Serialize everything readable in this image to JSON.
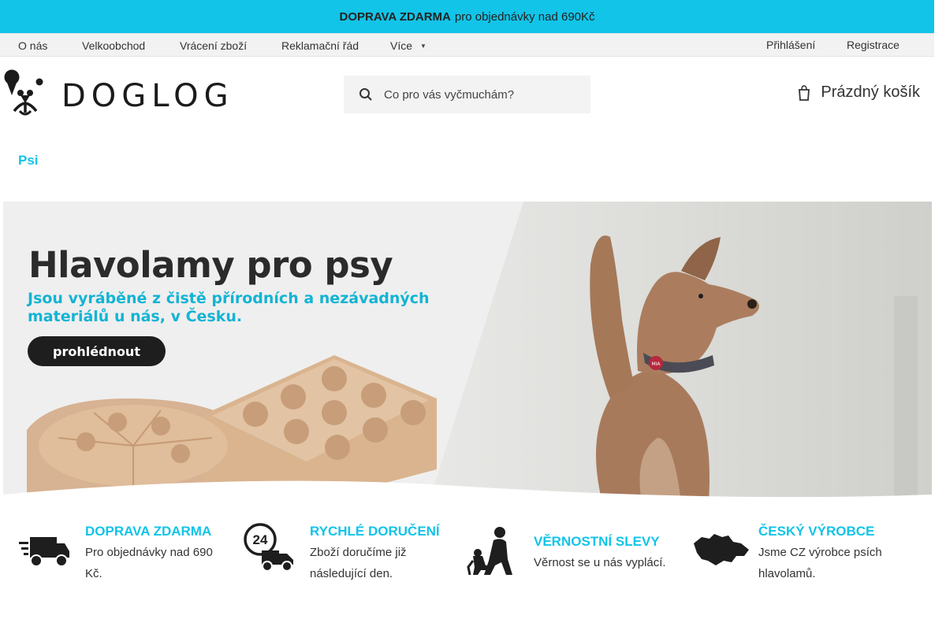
{
  "promo": {
    "bold": "DOPRAVA ZDARMA",
    "text": "pro objednávky nad 690Kč"
  },
  "topnav": {
    "left_items": [
      "O nás",
      "Velkoobchod",
      "Vrácení zboží",
      "Reklamační řád",
      "Více"
    ],
    "right_items": [
      "Přihlášení",
      "Registrace"
    ]
  },
  "logo": {
    "text": "DOGLOG"
  },
  "search": {
    "placeholder": "Co pro vás vyčmuchám?",
    "icon": "search-icon"
  },
  "cart": {
    "label": "Prázdný košík",
    "icon": "cart-icon"
  },
  "breadcrumb": {
    "current": "Psi"
  },
  "banner": {
    "title": "Hlavolamy pro psy",
    "subtitle": "Jsou vyráběné z čistě přírodních a nezávadných materiálů u nás, v Česku.",
    "button": "prohlédnout",
    "tag_text": "MIA"
  },
  "features": [
    {
      "icon": "delivery-truck-icon",
      "title": "DOPRAVA ZDARMA",
      "text": "Pro objednávky nad 690 Kč."
    },
    {
      "icon": "24h-delivery-icon",
      "icon_text": "24",
      "title": "RYCHLÉ DORUČENÍ",
      "text": "Zboží doručíme již následující den."
    },
    {
      "icon": "loyalty-person-dog-icon",
      "title": "VĚRNOSTNÍ SLEVY",
      "text": "Věrnost se u nás vyplácí."
    },
    {
      "icon": "czech-map-icon",
      "title": "ČESKÝ VÝROBCE",
      "text": "Jsme CZ výrobce psích hlavolamů."
    }
  ],
  "colors": {
    "accent": "#12c4e8",
    "dark": "#1e1e1e",
    "banner_subtitle": "#12b4d4"
  }
}
